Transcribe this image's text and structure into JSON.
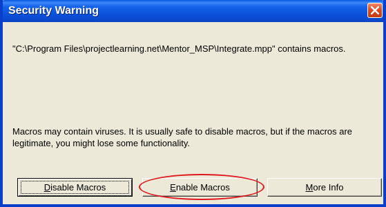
{
  "window": {
    "title": "Security Warning",
    "close_icon": "close-x-icon",
    "accent_color": "#0a4fd8",
    "close_color": "#de4a22"
  },
  "content": {
    "message": "\"C:\\Program Files\\projectlearning.net\\Mentor_MSP\\Integrate.mpp\" contains macros.",
    "warning": "Macros may contain viruses. It is usually safe to disable macros, but if the macros are legitimate, you might lose some functionality."
  },
  "buttons": {
    "disable": {
      "mnemonic": "D",
      "rest": "isable Macros",
      "focused": true
    },
    "enable": {
      "mnemonic": "E",
      "rest": "nable Macros",
      "highlighted": true,
      "highlight_color": "#e0161c"
    },
    "more": {
      "mnemonic": "M",
      "rest": "ore Info"
    }
  }
}
